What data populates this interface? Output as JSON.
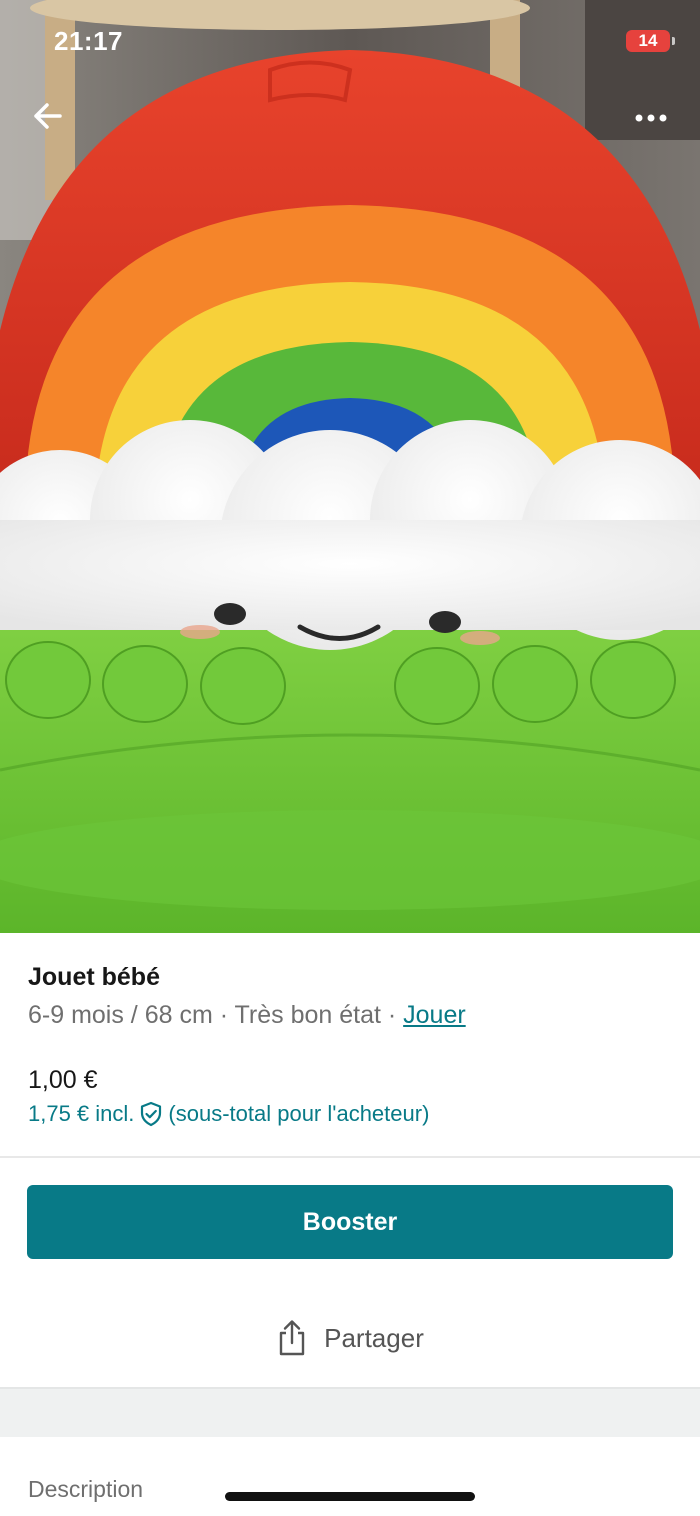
{
  "status_bar": {
    "time": "21:17",
    "battery_level": "14",
    "battery_color": "#e6423d"
  },
  "nav": {
    "back_icon": "arrow-left-icon",
    "more_icon": "more-horizontal-icon"
  },
  "photo": {
    "subject": "rainbow-cloud-stacker-toy"
  },
  "item": {
    "title": "Jouet bébé",
    "size": "6-9 mois / 68 cm",
    "separator_1": " · ",
    "condition": "Très bon état",
    "separator_2": " · ",
    "category": "Jouer",
    "price": "1,00 €",
    "price_incl": "1,75 € incl.",
    "price_note": "(sous-total pour l'acheteur)",
    "protection_icon": "shield-check-icon"
  },
  "actions": {
    "booster_label": "Booster",
    "share_label": "Partager",
    "share_icon": "share-icon"
  },
  "sections": {
    "description_label": "Description"
  },
  "colors": {
    "accent": "#087a87",
    "muted_text": "#6f6f6f",
    "band": "#eff1f1"
  }
}
